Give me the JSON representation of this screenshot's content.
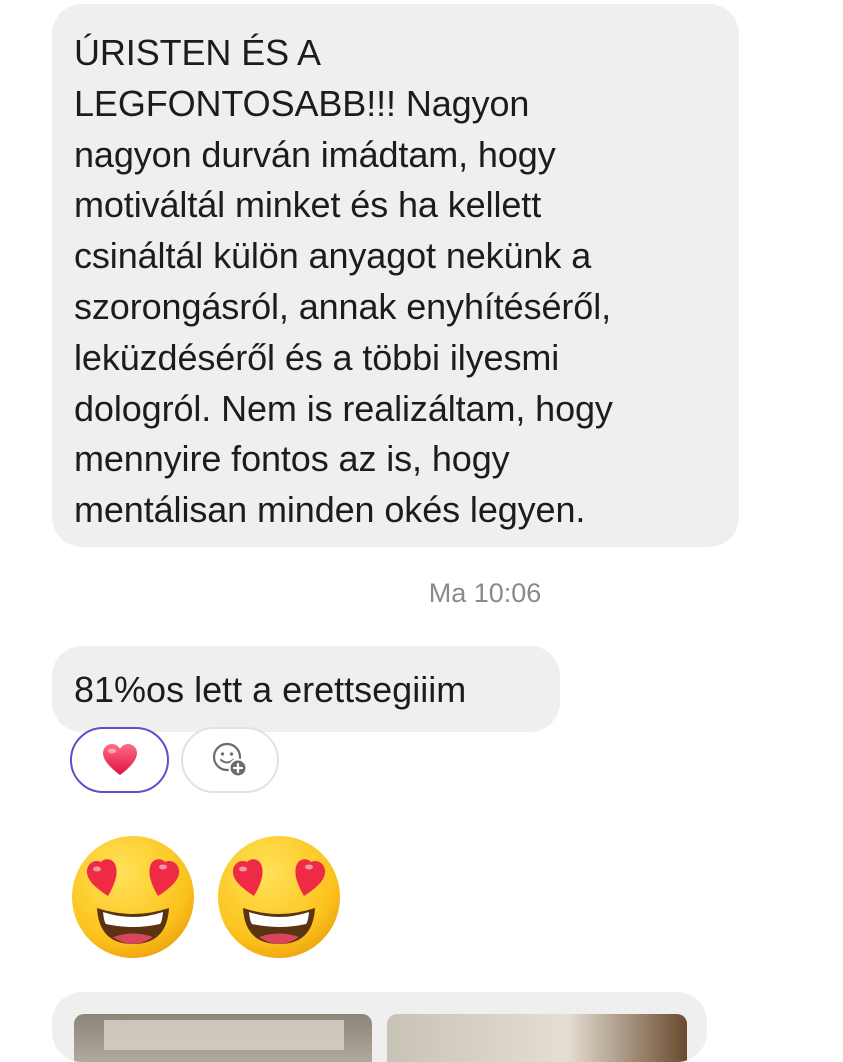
{
  "messages": {
    "long": "ÚRISTEN ÉS A\nLEGFONTOSABB!!! Nagyon\nnagyon durván imádtam, hogy\nmotiváltál minket és ha kellett\ncsináltál külön anyagot nekünk a\nszorongásról, annak enyhítéséről,\nleküzdéséről és a többi ilyesmi\ndologról. Nem is realizáltam, hogy\nmennyire fontos az is, hogy\nmentálisan minden okés legyen.",
    "timestamp": "Ma 10:06",
    "short": "81%os lett a erettsegiiim"
  },
  "reactions": {
    "selected_icon": "heart-icon",
    "add_icon": "add-reaction-icon",
    "selected_border_color": "#5b52c8"
  },
  "emoji_message": {
    "icons": [
      "heart-eyes-emoji",
      "heart-eyes-emoji"
    ]
  },
  "colors": {
    "bubble_background": "#efeff0",
    "timestamp_color": "#8a8a8e"
  }
}
